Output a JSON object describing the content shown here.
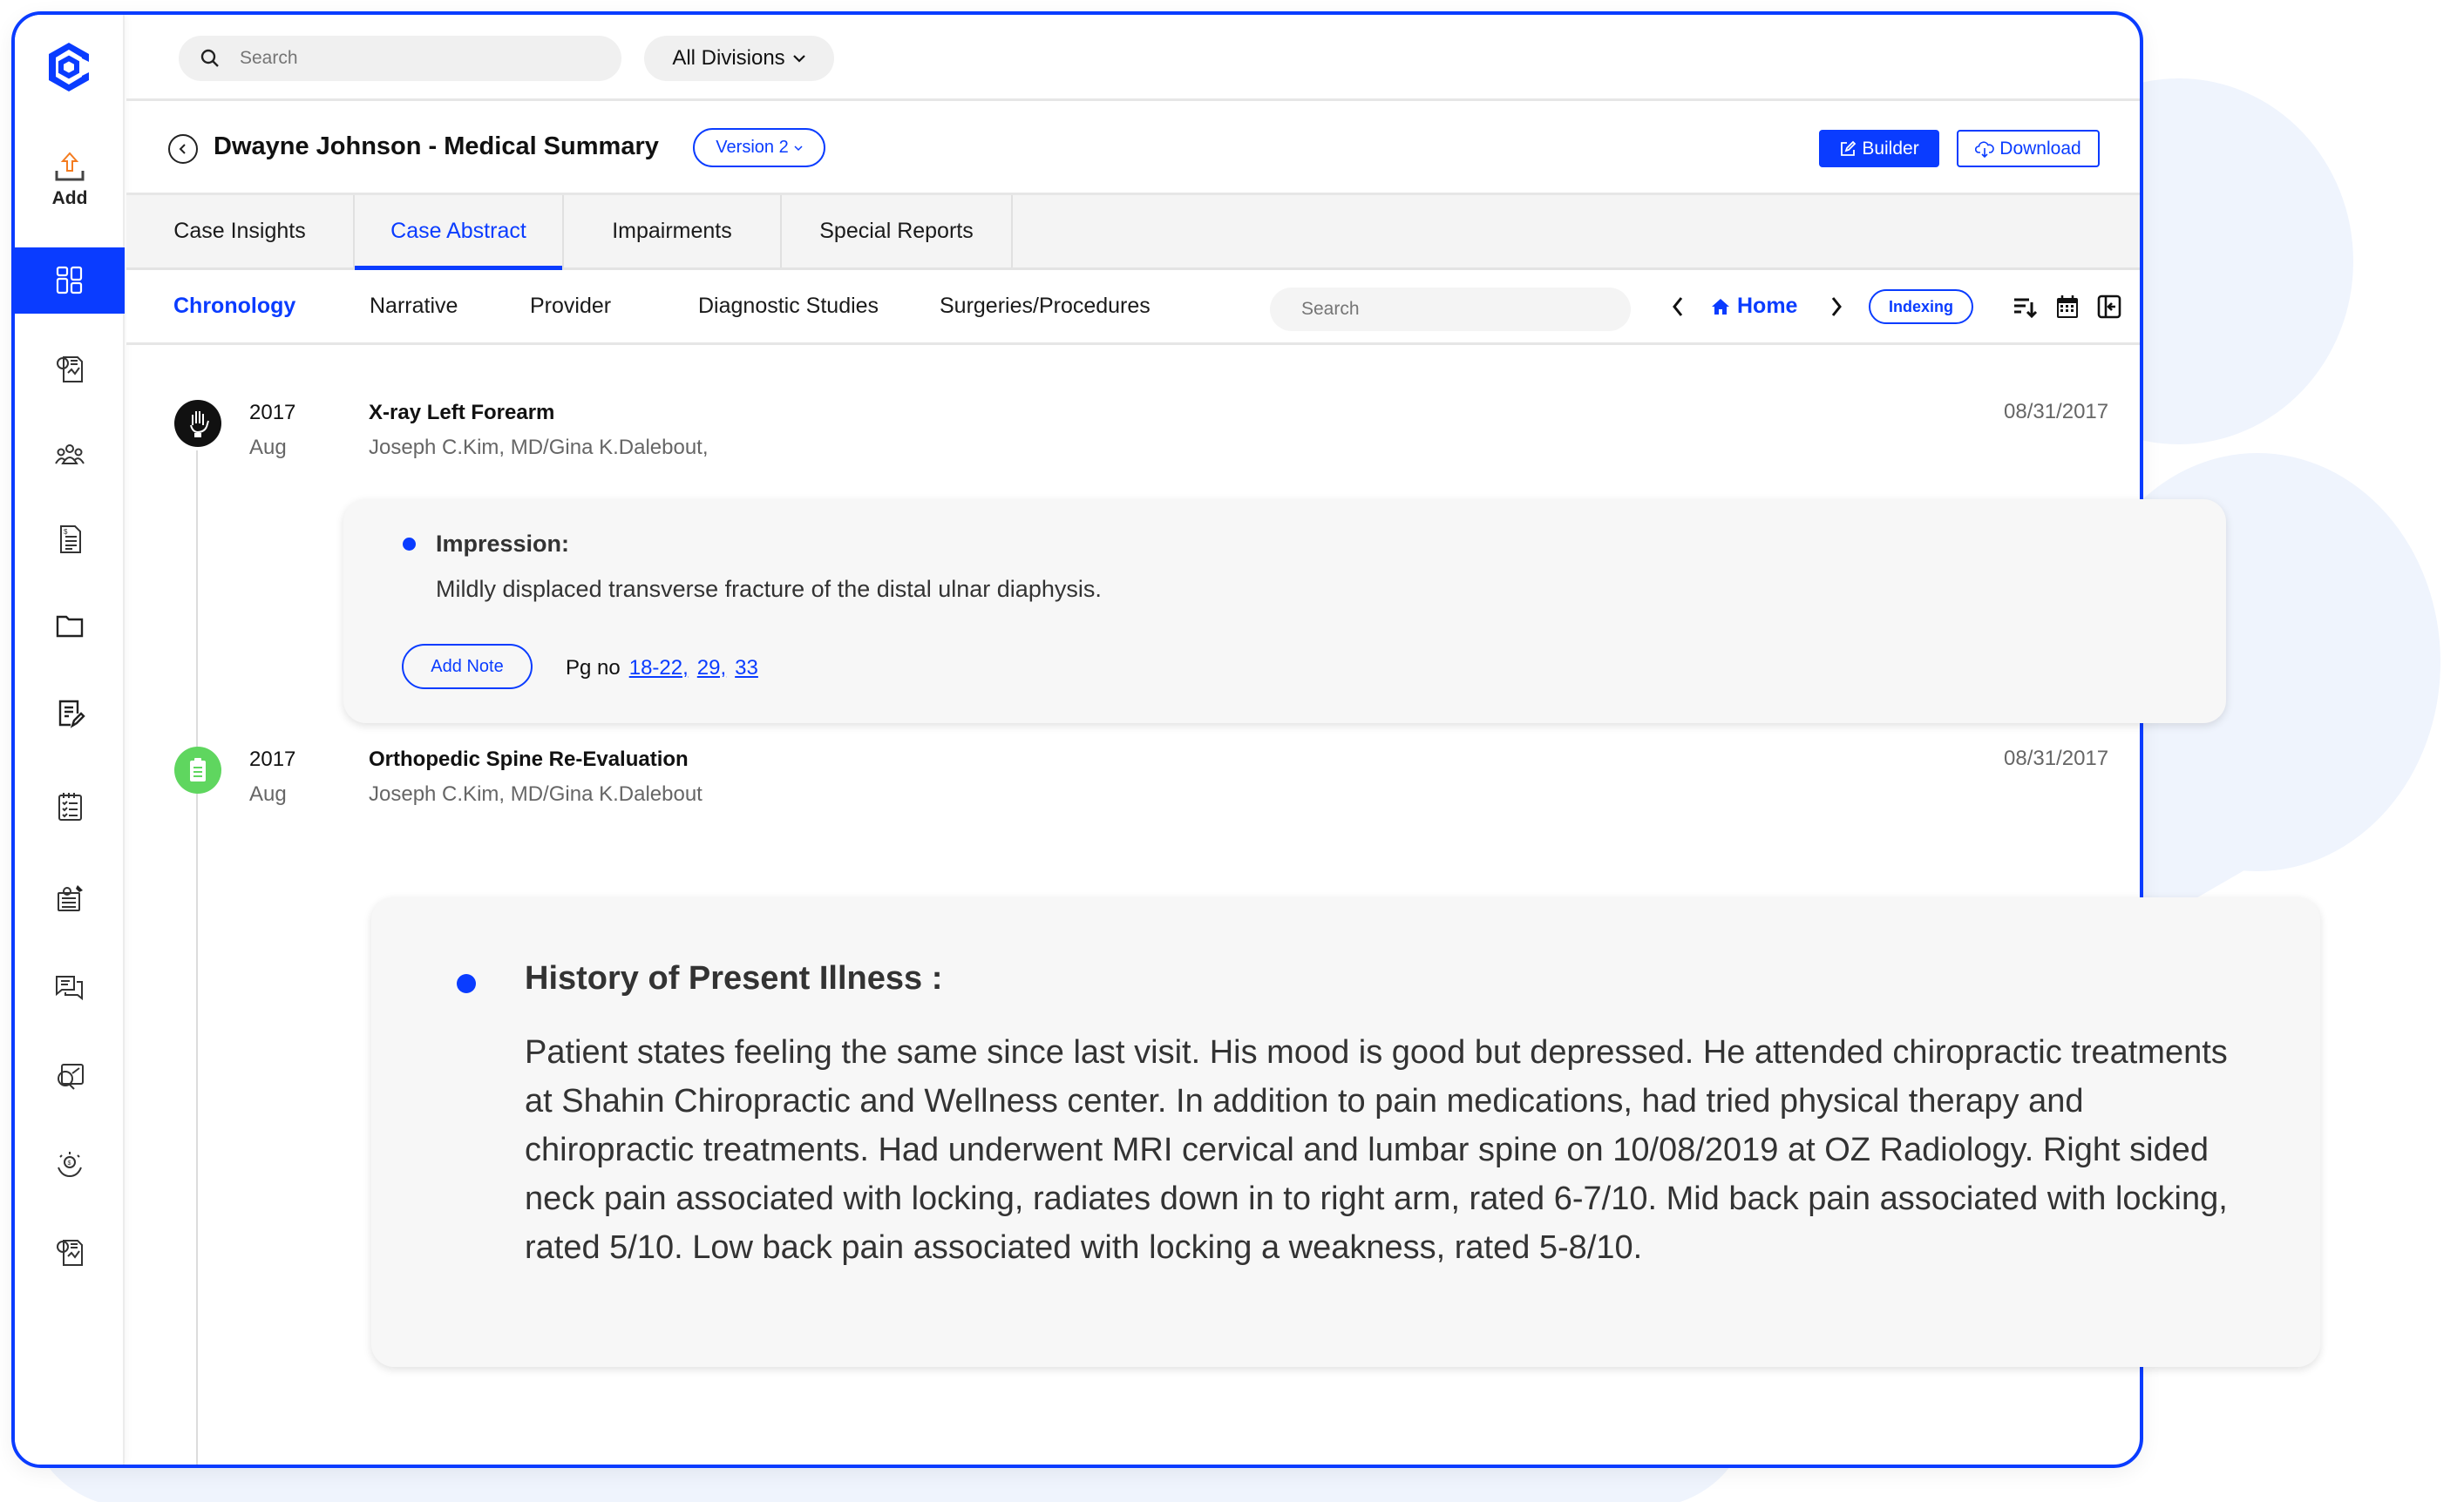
{
  "colors": {
    "accent": "#0a3cff",
    "card_bg": "#f7f7f7",
    "bg_blob": "#eff4fd",
    "green_icon": "#5fd65f",
    "add_icon": "#f47c20"
  },
  "sidebar": {
    "add_label": "Add",
    "items": [
      {
        "icon": "dashboard-grid-icon",
        "active": true
      },
      {
        "icon": "report-chart-icon",
        "active": false
      },
      {
        "icon": "people-group-icon",
        "active": false
      },
      {
        "icon": "invoice-document-icon",
        "active": false
      },
      {
        "icon": "folder-icon",
        "active": false
      },
      {
        "icon": "edit-note-icon",
        "active": false
      },
      {
        "icon": "checklist-icon",
        "active": false
      },
      {
        "icon": "pinned-notes-icon",
        "active": false
      },
      {
        "icon": "chat-bubbles-icon",
        "active": false
      },
      {
        "icon": "analytics-search-icon",
        "active": false
      },
      {
        "icon": "settlement-money-icon",
        "active": false
      },
      {
        "icon": "report-chart-icon",
        "active": false
      }
    ]
  },
  "topbar": {
    "search_placeholder": "Search",
    "division_label": "All Divisions"
  },
  "header": {
    "title": "Dwayne Johnson - Medical Summary",
    "version_label": "Version 2",
    "builder_label": "Builder",
    "download_label": "Download"
  },
  "tabs": [
    {
      "label": "Case Insights",
      "active": false
    },
    {
      "label": "Case Abstract",
      "active": true
    },
    {
      "label": "Impairments",
      "active": false
    },
    {
      "label": "Special Reports",
      "active": false
    }
  ],
  "subnav": {
    "tabs": [
      {
        "label": "Chronology",
        "active": true
      },
      {
        "label": "Narrative",
        "active": false
      },
      {
        "label": "Provider",
        "active": false
      },
      {
        "label": "Diagnostic Studies",
        "active": false
      },
      {
        "label": "Surgeries/Procedures",
        "active": false
      }
    ],
    "search_placeholder": "Search",
    "home_label": "Home",
    "indexing_label": "Indexing"
  },
  "entries": [
    {
      "year": "2017",
      "month": "Aug",
      "title": "X-ray Left Forearm",
      "provider": "Joseph C.Kim, MD/Gina K.Dalebout,",
      "date": "08/31/2017",
      "icon": "xray-hand-icon",
      "card": {
        "heading": "Impression:",
        "body": "Mildly displaced transverse fracture of the distal ulnar diaphysis.",
        "add_note_label": "Add Note",
        "pg_label": "Pg no",
        "pages": [
          "18-22,",
          "29,",
          "33"
        ]
      }
    },
    {
      "year": "2017",
      "month": "Aug",
      "title": "Orthopedic Spine Re-Evaluation",
      "provider": "Joseph C.Kim, MD/Gina K.Dalebout",
      "date": "08/31/2017",
      "icon": "clipboard-icon",
      "card": {
        "heading": "History of Present Illness :",
        "body": "Patient states feeling the same since last visit. His mood is good but depressed. He attended chiropractic treatments at Shahin Chiropractic and Wellness center. In addition to pain medications, had tried physical therapy and chiropractic treatments. Had underwent MRI cervical and lumbar spine on 10/08/2019 at OZ Radiology. Right sided neck pain associated with locking, radiates down in to right arm, rated 6-7/10. Mid back pain associated with locking, rated 5/10. Low back pain associated with locking a weakness, rated 5-8/10."
      }
    }
  ]
}
